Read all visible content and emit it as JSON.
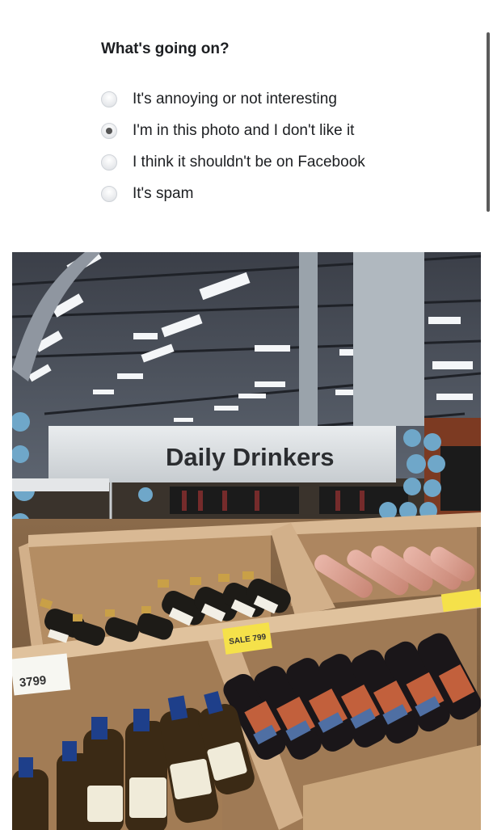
{
  "report": {
    "question": "What's going on?",
    "options": [
      {
        "label": "It's annoying or not interesting",
        "selected": false
      },
      {
        "label": "I'm in this photo and I don't like it",
        "selected": true
      },
      {
        "label": "I think it shouldn't be on Facebook",
        "selected": false
      },
      {
        "label": "It's spam",
        "selected": false
      }
    ]
  },
  "photo": {
    "sign_text": "Daily Drinkers",
    "price_tags": [
      "3799",
      "SALE 799"
    ]
  }
}
